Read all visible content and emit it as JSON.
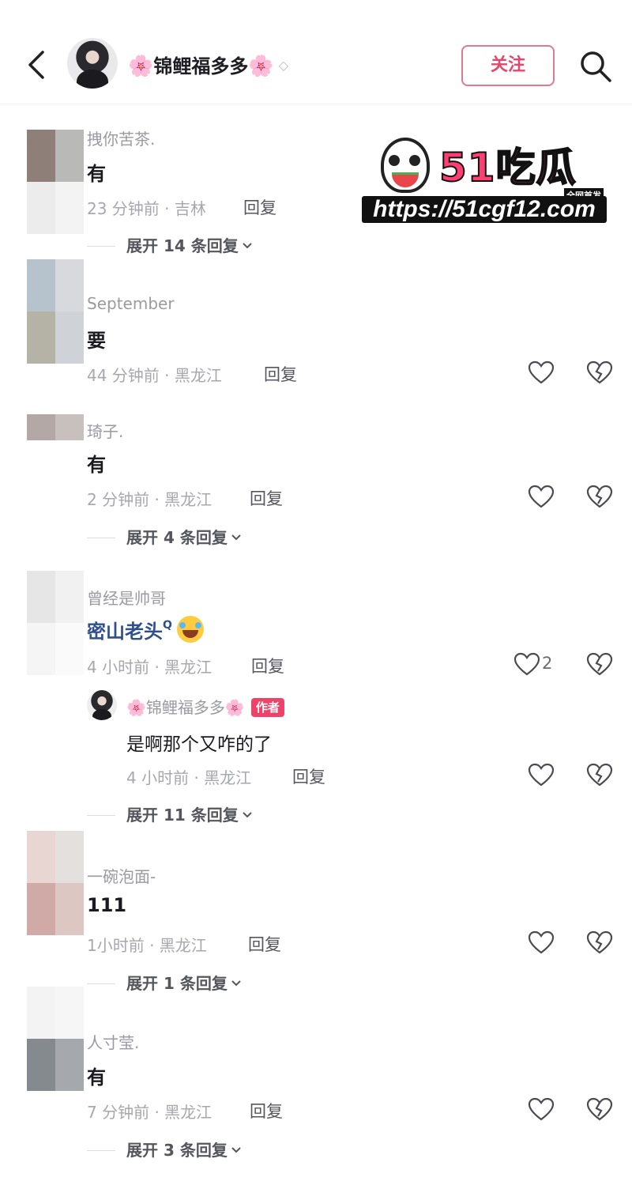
{
  "header": {
    "author_name": "锦鲤福多多",
    "flower_glyph": "🌸",
    "follow_label": "关注",
    "back_icon": "chevron-left-icon",
    "search_icon": "search-icon"
  },
  "watermark": {
    "brand": "51吃瓜",
    "tag": "全网首发",
    "url": "https://51cgf12.com"
  },
  "reply_label": "回复",
  "author_badge": "作者",
  "comments": [
    {
      "name": "拽你苦茶.",
      "text": "有",
      "time": "23 分钟前 · 吉林",
      "expand": "展开 14 条回复"
    },
    {
      "name": "September",
      "text": "要",
      "time": "44 分钟前 · 黑龙江"
    },
    {
      "name": "琦子.",
      "text": "有",
      "time": "2 分钟前 · 黑龙江",
      "expand": "展开 4 条回复"
    },
    {
      "name": "曾经是帅哥",
      "text": "密山老头",
      "time": "4 小时前 · 黑龙江",
      "likes": "2",
      "expand": "展开 11 条回复"
    },
    {
      "name": "一碗泡面-",
      "text": "111",
      "time": "1小时前 · 黑龙江",
      "expand": "展开 1 条回复"
    },
    {
      "name": "人寸莹.",
      "text": "有",
      "time": "7 分钟前 · 黑龙江",
      "expand": "展开 3 条回复"
    }
  ],
  "author_reply": {
    "name": "锦鲤福多多",
    "text": "是啊那个又咋的了",
    "time": "4 小时前 · 黑龙江"
  },
  "colors": {
    "follow_border": "#e07a93",
    "follow_text": "#e4476b",
    "badge_bg": "#ee4368",
    "link_text": "#2f4f8f"
  }
}
